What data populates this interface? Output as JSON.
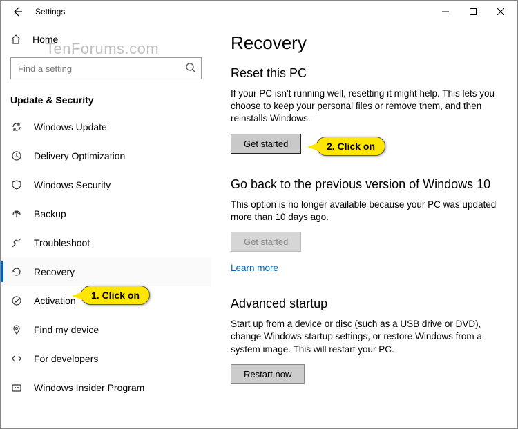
{
  "window": {
    "title": "Settings"
  },
  "watermark": "TenForums.com",
  "sidebar": {
    "home": "Home",
    "search_placeholder": "Find a setting",
    "section": "Update & Security",
    "items": [
      {
        "label": "Windows Update"
      },
      {
        "label": "Delivery Optimization"
      },
      {
        "label": "Windows Security"
      },
      {
        "label": "Backup"
      },
      {
        "label": "Troubleshoot"
      },
      {
        "label": "Recovery"
      },
      {
        "label": "Activation"
      },
      {
        "label": "Find my device"
      },
      {
        "label": "For developers"
      },
      {
        "label": "Windows Insider Program"
      }
    ],
    "selected_index": 5
  },
  "page": {
    "title": "Recovery",
    "reset": {
      "heading": "Reset this PC",
      "desc": "If your PC isn't running well, resetting it might help. This lets you choose to keep your personal files or remove them, and then reinstalls Windows.",
      "button": "Get started"
    },
    "goback": {
      "heading": "Go back to the previous version of Windows 10",
      "desc": "This option is no longer available because your PC was updated more than 10 days ago.",
      "button": "Get started",
      "learn_more": "Learn more"
    },
    "advanced": {
      "heading": "Advanced startup",
      "desc": "Start up from a device or disc (such as a USB drive or DVD), change Windows startup settings, or restore Windows from a system image. This will restart your PC.",
      "button": "Restart now"
    }
  },
  "callouts": {
    "one": "1. Click on",
    "two": "2. Click on"
  }
}
